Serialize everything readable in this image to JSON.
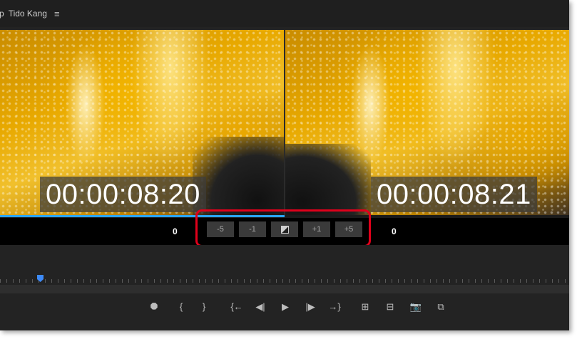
{
  "header": {
    "left_fragment": "p",
    "user_name": "Tido Kang",
    "menu_icon": "hamburger-menu-icon"
  },
  "viewer": {
    "left_timecode": "00:00:08:20",
    "right_timecode": "00:00:08:21",
    "left_value": "0",
    "right_value": "0",
    "progress_fraction": 0.5,
    "accent_color": "#2aa5ff"
  },
  "trim_buttons": [
    {
      "label": "-5"
    },
    {
      "label": "-1"
    },
    {
      "label": "",
      "icon": "compare-split-icon"
    },
    {
      "label": "+1"
    },
    {
      "label": "+5"
    }
  ],
  "highlight_color": "#e0001b",
  "timeline": {
    "playhead_color": "#3d8af7"
  },
  "transport": {
    "icons": [
      "marker-icon",
      "mark-in-icon",
      "mark-out-icon",
      "go-to-in-icon",
      "step-back-icon",
      "play-icon",
      "step-forward-icon",
      "go-to-out-icon",
      "insert-icon",
      "overwrite-icon",
      "export-frame-icon",
      "compare-view-icon"
    ],
    "glyphs": {
      "marker": "⯃",
      "mark_in": "{",
      "mark_out": "}",
      "go_in": "{←",
      "step_back": "◀|",
      "play": "▶",
      "step_fwd": "|▶",
      "go_out": "→}",
      "insert": "⊞",
      "overwrite": "⊟",
      "camera": "📷",
      "compare": "⧉"
    }
  }
}
